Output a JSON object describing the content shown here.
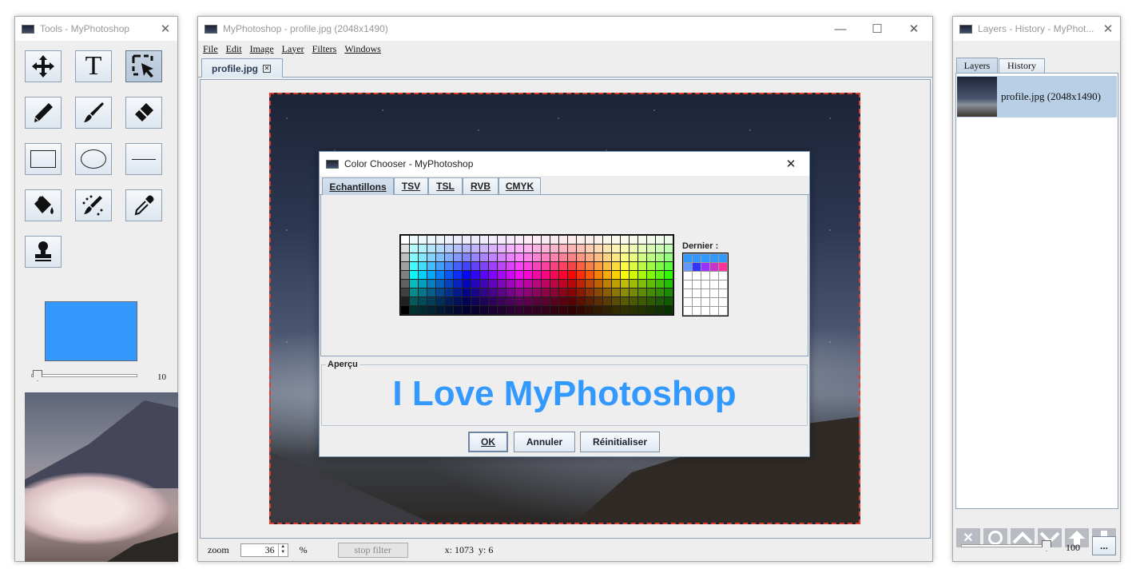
{
  "tools_window": {
    "title": "Tools - MyPhotoshop",
    "brush_size": "10",
    "current_color": "#3399ff",
    "tools": [
      "move-tool",
      "text-tool",
      "selection-tool",
      "pencil-tool",
      "brush-tool",
      "eraser-tool",
      "rectangle-tool",
      "ellipse-tool",
      "line-tool",
      "fill-tool",
      "filter-brush-tool",
      "eyedropper-tool",
      "stamp-tool"
    ]
  },
  "main_window": {
    "title": "MyPhotoshop - profile.jpg (2048x1490)",
    "menu": [
      "File",
      "Edit",
      "Image",
      "Layer",
      "Filters",
      "Windows"
    ],
    "tab_label": "profile.jpg",
    "zoom_label": "zoom",
    "zoom_value": "36",
    "zoom_unit": "%",
    "stop_filter": "stop filter",
    "coords": "x: 1073  y: 6"
  },
  "color_chooser": {
    "title": "Color Chooser - MyPhotoshop",
    "tabs": [
      "Echantillons",
      "TSV",
      "TSL",
      "RVB",
      "CMYK"
    ],
    "recent_label": "Dernier :",
    "preview_label": "Aperçu",
    "preview_text": "I Love MyPhotoshop",
    "preview_color": "#3399ff",
    "ok": "OK",
    "cancel": "Annuler",
    "reset": "Réinitialiser"
  },
  "layers_window": {
    "title": "Layers - History - MyPhot...",
    "tabs": [
      "Layers",
      "History"
    ],
    "layer_name": "profile.jpg (2048x1490)",
    "opacity": "100",
    "more_button": "..."
  }
}
